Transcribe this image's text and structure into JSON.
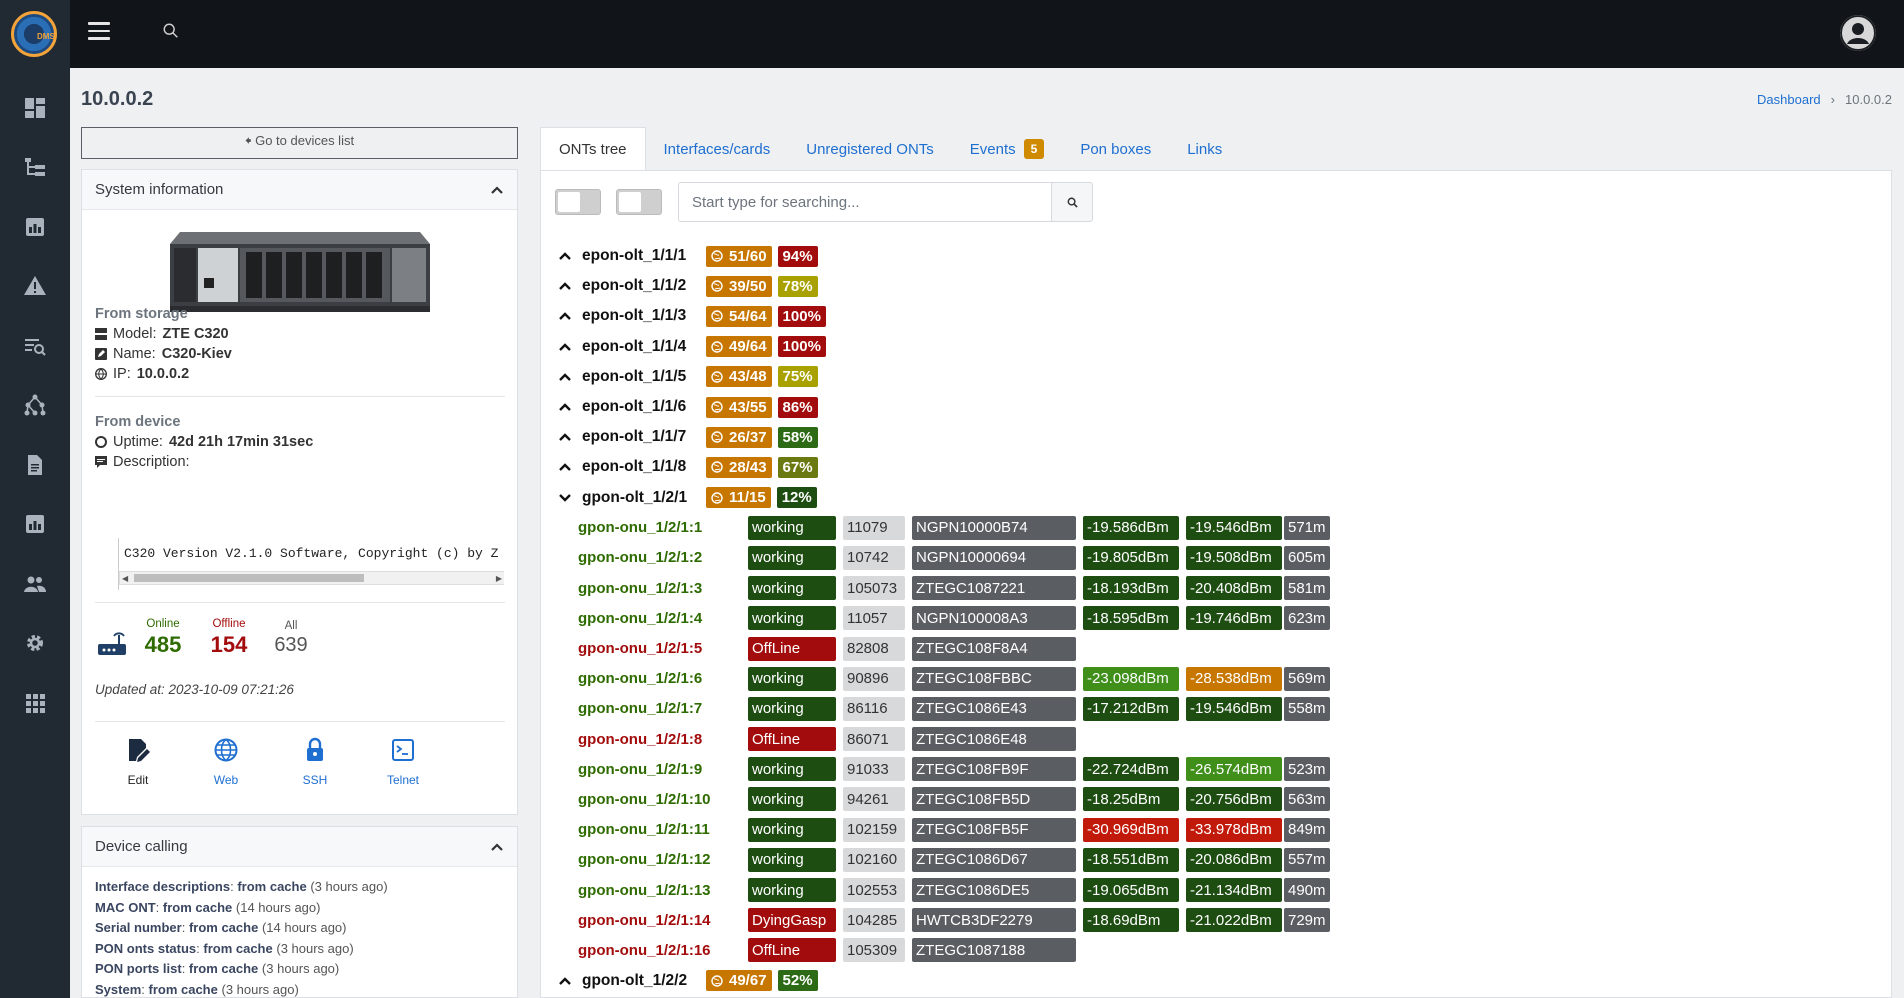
{
  "app": {
    "logo_text": "DMS"
  },
  "sidebar": {
    "items": [
      {
        "icon": "dashboard-icon"
      },
      {
        "icon": "tree-icon"
      },
      {
        "icon": "device-icon"
      },
      {
        "icon": "warning-icon"
      },
      {
        "icon": "search-list-icon"
      },
      {
        "icon": "topology-icon"
      },
      {
        "icon": "document-icon"
      },
      {
        "icon": "device-icon"
      },
      {
        "icon": "users-icon"
      },
      {
        "icon": "gear-icon"
      },
      {
        "icon": "apps-icon"
      }
    ]
  },
  "page": {
    "title": "10.0.0.2"
  },
  "breadcrumb": {
    "home": "Dashboard",
    "sep": "›",
    "current": "10.0.0.2"
  },
  "back_button": "🠸 Go to devices list",
  "system_info": {
    "title": "System information",
    "from_storage": "From storage",
    "model_label": "Model:",
    "model": "ZTE C320",
    "name_label": "Name:",
    "name": "C320-Kiev",
    "ip_label": "IP:",
    "ip": "10.0.0.2",
    "from_device": "From device",
    "uptime_label": "Uptime:",
    "uptime": "42d 21h 17min 31sec",
    "description_label": "Description:",
    "description": "C320 Version V2.1.0 Software, Copyright (c) by Z",
    "online_label": "Online",
    "online": "485",
    "offline_label": "Offline",
    "offline": "154",
    "all_label": "All",
    "all": "639",
    "updated": "Updated at: 2023-10-09 07:21:26",
    "actions": [
      {
        "label": "Edit",
        "icon": "edit-icon"
      },
      {
        "label": "Web",
        "icon": "globe-icon"
      },
      {
        "label": "SSH",
        "icon": "lock-icon"
      },
      {
        "label": "Telnet",
        "icon": "terminal-icon"
      }
    ]
  },
  "device_calling": {
    "title": "Device calling",
    "items": [
      {
        "name": "Interface descriptions",
        "source": "from cache",
        "age": "(3 hours ago)"
      },
      {
        "name": "MAC ONT",
        "source": "from cache",
        "age": "(14 hours ago)"
      },
      {
        "name": "Serial number",
        "source": "from cache",
        "age": "(14 hours ago)"
      },
      {
        "name": "PON onts status",
        "source": "from cache",
        "age": "(3 hours ago)"
      },
      {
        "name": "PON ports list",
        "source": "from cache",
        "age": "(3 hours ago)"
      },
      {
        "name": "System",
        "source": "from cache",
        "age": "(3 hours ago)"
      }
    ]
  },
  "tabs": [
    {
      "label": "ONTs tree",
      "active": true
    },
    {
      "label": "Interfaces/cards"
    },
    {
      "label": "Unregistered ONTs"
    },
    {
      "label": "Events",
      "badge": "5"
    },
    {
      "label": "Pon boxes"
    },
    {
      "label": "Links"
    }
  ],
  "search": {
    "placeholder": "Start type for searching..."
  },
  "colors": {
    "count": "#c77700",
    "red": "#a30c0c",
    "olive": "#a8a100",
    "green": "#2d6a16",
    "dark_green": "#1e4d12",
    "mid_olive": "#6b7a10",
    "orange": "#c77700",
    "bright_green": "#3f8f1a",
    "red_bright": "#c21a0a",
    "green_text": "#2e6b00",
    "red_text": "#a30c0c"
  },
  "olts": [
    {
      "name": "epon-olt_1/1/1",
      "count": "51/60",
      "pct": "94%",
      "pct_color": "#a30c0c",
      "expanded": false
    },
    {
      "name": "epon-olt_1/1/2",
      "count": "39/50",
      "pct": "78%",
      "pct_color": "#a8a100",
      "expanded": false
    },
    {
      "name": "epon-olt_1/1/3",
      "count": "54/64",
      "pct": "100%",
      "pct_color": "#a30c0c",
      "expanded": false
    },
    {
      "name": "epon-olt_1/1/4",
      "count": "49/64",
      "pct": "100%",
      "pct_color": "#a30c0c",
      "expanded": false
    },
    {
      "name": "epon-olt_1/1/5",
      "count": "43/48",
      "pct": "75%",
      "pct_color": "#a8a100",
      "expanded": false
    },
    {
      "name": "epon-olt_1/1/6",
      "count": "43/55",
      "pct": "86%",
      "pct_color": "#a30c0c",
      "expanded": false
    },
    {
      "name": "epon-olt_1/1/7",
      "count": "26/37",
      "pct": "58%",
      "pct_color": "#2d6a16",
      "expanded": false
    },
    {
      "name": "epon-olt_1/1/8",
      "count": "28/43",
      "pct": "67%",
      "pct_color": "#6b7a10",
      "expanded": false
    },
    {
      "name": "gpon-olt_1/2/1",
      "count": "11/15",
      "pct": "12%",
      "pct_color": "#1e4d12",
      "expanded": true
    },
    {
      "name": "gpon-olt_1/2/2",
      "count": "49/67",
      "pct": "52%",
      "pct_color": "#2d6a16",
      "expanded": false
    }
  ],
  "onus": [
    {
      "name": "gpon-onu_1/2/1:1",
      "status": "working",
      "id": "11079",
      "sn": "NGPN10000B74",
      "rx": "-19.586dBm",
      "rx_c": "#1e4d12",
      "tx": "-19.546dBm",
      "tx_c": "#1e4d12",
      "dist": "571m"
    },
    {
      "name": "gpon-onu_1/2/1:2",
      "status": "working",
      "id": "10742",
      "sn": "NGPN10000694",
      "rx": "-19.805dBm",
      "rx_c": "#1e4d12",
      "tx": "-19.508dBm",
      "tx_c": "#1e4d12",
      "dist": "605m"
    },
    {
      "name": "gpon-onu_1/2/1:3",
      "status": "working",
      "id": "105073",
      "sn": "ZTEGC1087221",
      "rx": "-18.193dBm",
      "rx_c": "#1e4d12",
      "tx": "-20.408dBm",
      "tx_c": "#1e4d12",
      "dist": "581m"
    },
    {
      "name": "gpon-onu_1/2/1:4",
      "status": "working",
      "id": "11057",
      "sn": "NGPN100008A3",
      "rx": "-18.595dBm",
      "rx_c": "#1e4d12",
      "tx": "-19.746dBm",
      "tx_c": "#1e4d12",
      "dist": "623m"
    },
    {
      "name": "gpon-onu_1/2/1:5",
      "status": "OffLine",
      "id": "82808",
      "sn": "ZTEGC108F8A4",
      "rx": "",
      "tx": "",
      "dist": ""
    },
    {
      "name": "gpon-onu_1/2/1:6",
      "status": "working",
      "id": "90896",
      "sn": "ZTEGC108FBBC",
      "rx": "-23.098dBm",
      "rx_c": "#3f8f1a",
      "tx": "-28.538dBm",
      "tx_c": "#c77700",
      "dist": "569m"
    },
    {
      "name": "gpon-onu_1/2/1:7",
      "status": "working",
      "id": "86116",
      "sn": "ZTEGC1086E43",
      "rx": "-17.212dBm",
      "rx_c": "#1e4d12",
      "tx": "-19.546dBm",
      "tx_c": "#1e4d12",
      "dist": "558m"
    },
    {
      "name": "gpon-onu_1/2/1:8",
      "status": "OffLine",
      "id": "86071",
      "sn": "ZTEGC1086E48",
      "rx": "",
      "tx": "",
      "dist": ""
    },
    {
      "name": "gpon-onu_1/2/1:9",
      "status": "working",
      "id": "91033",
      "sn": "ZTEGC108FB9F",
      "rx": "-22.724dBm",
      "rx_c": "#1e4d12",
      "tx": "-26.574dBm",
      "tx_c": "#3f8f1a",
      "dist": "523m"
    },
    {
      "name": "gpon-onu_1/2/1:10",
      "status": "working",
      "id": "94261",
      "sn": "ZTEGC108FB5D",
      "rx": "-18.25dBm",
      "rx_c": "#1e4d12",
      "tx": "-20.756dBm",
      "tx_c": "#1e4d12",
      "dist": "563m"
    },
    {
      "name": "gpon-onu_1/2/1:11",
      "status": "working",
      "id": "102159",
      "sn": "ZTEGC108FB5F",
      "rx": "-30.969dBm",
      "rx_c": "#c21a0a",
      "tx": "-33.978dBm",
      "tx_c": "#c21a0a",
      "dist": "849m"
    },
    {
      "name": "gpon-onu_1/2/1:12",
      "status": "working",
      "id": "102160",
      "sn": "ZTEGC1086D67",
      "rx": "-18.551dBm",
      "rx_c": "#1e4d12",
      "tx": "-20.086dBm",
      "tx_c": "#1e4d12",
      "dist": "557m"
    },
    {
      "name": "gpon-onu_1/2/1:13",
      "status": "working",
      "id": "102553",
      "sn": "ZTEGC1086DE5",
      "rx": "-19.065dBm",
      "rx_c": "#1e4d12",
      "tx": "-21.134dBm",
      "tx_c": "#1e4d12",
      "dist": "490m"
    },
    {
      "name": "gpon-onu_1/2/1:14",
      "status": "DyingGasp",
      "id": "104285",
      "sn": "HWTCB3DF2279",
      "rx": "-18.69dBm",
      "rx_c": "#1e4d12",
      "tx": "-21.022dBm",
      "tx_c": "#1e4d12",
      "dist": "729m"
    },
    {
      "name": "gpon-onu_1/2/1:16",
      "status": "OffLine",
      "id": "105309",
      "sn": "ZTEGC1087188",
      "rx": "",
      "tx": "",
      "dist": ""
    }
  ]
}
